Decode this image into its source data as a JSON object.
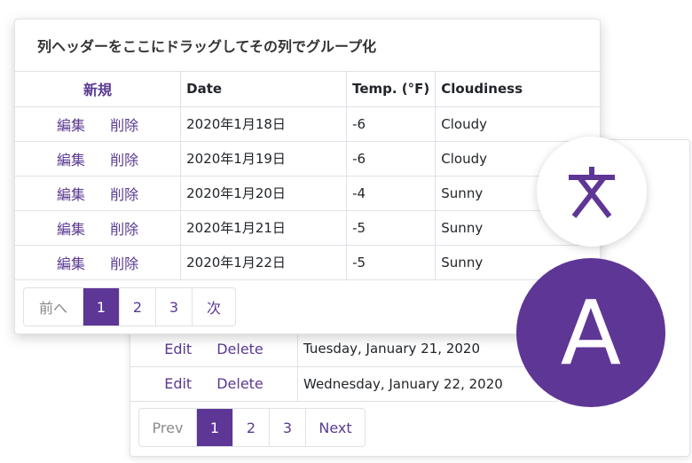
{
  "back_grid": {
    "rows": [
      {
        "edit": "Edit",
        "delete": "Delete",
        "date": "Tuesday, January 21, 2020"
      },
      {
        "edit": "Edit",
        "delete": "Delete",
        "date": "Wednesday, January 22, 2020"
      }
    ],
    "pager": {
      "prev": "Prev",
      "pages": [
        "1",
        "2",
        "3"
      ],
      "next": "Next",
      "active_page": "1"
    }
  },
  "front_grid": {
    "group_panel": "列ヘッダーをここにドラッグしてその列でグループ化",
    "headers": {
      "new": "新規",
      "date": "Date",
      "temp": "Temp. (°F)",
      "cloudiness": "Cloudiness"
    },
    "rows": [
      {
        "edit": "編集",
        "delete": "削除",
        "date": "2020年1月18日",
        "temp": "-6",
        "cloudiness": "Cloudy"
      },
      {
        "edit": "編集",
        "delete": "削除",
        "date": "2020年1月19日",
        "temp": "-6",
        "cloudiness": "Cloudy"
      },
      {
        "edit": "編集",
        "delete": "削除",
        "date": "2020年1月20日",
        "temp": "-4",
        "cloudiness": "Sunny"
      },
      {
        "edit": "編集",
        "delete": "削除",
        "date": "2020年1月21日",
        "temp": "-5",
        "cloudiness": "Sunny"
      },
      {
        "edit": "編集",
        "delete": "削除",
        "date": "2020年1月22日",
        "temp": "-5",
        "cloudiness": "Sunny"
      }
    ],
    "pager": {
      "prev": "前へ",
      "pages": [
        "1",
        "2",
        "3"
      ],
      "next": "次",
      "active_page": "1"
    }
  },
  "badges": {
    "letter": "A",
    "translate_icon": "translate-icon",
    "accent_color": "#5e3696"
  }
}
